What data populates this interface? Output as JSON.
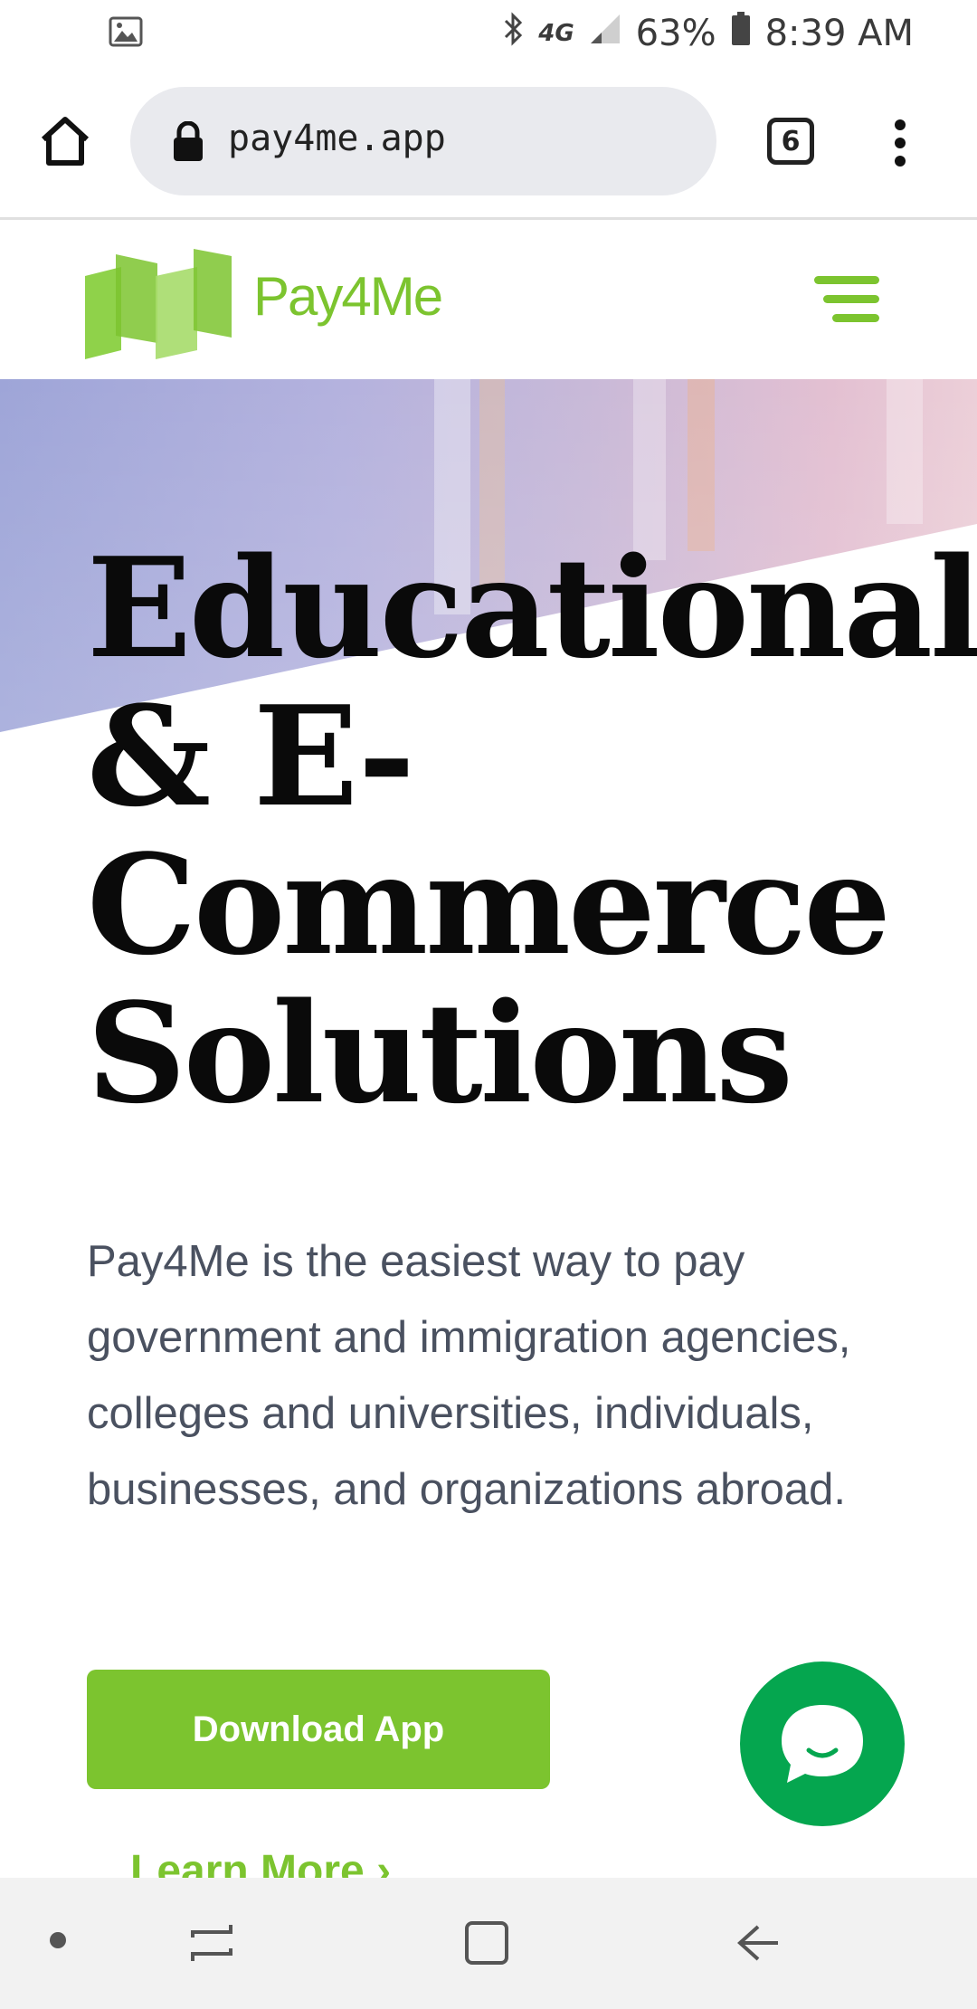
{
  "status_bar": {
    "network": "4G",
    "battery": "63%",
    "time": "8:39 AM"
  },
  "browser": {
    "url": "pay4me.app",
    "tab_count": "6"
  },
  "site": {
    "logo_text": "Pay4Me",
    "brand_color": "#7cc42f"
  },
  "hero": {
    "title_lines": [
      "Educational",
      "& E-",
      "Commerce",
      "Solutions"
    ],
    "description": "Pay4Me is the easiest way to pay government and immigration agencies, colleges and universities, individuals, businesses, and organizations abroad.",
    "download_label": "Download App",
    "learn_more_label": "Learn More"
  },
  "chat": {
    "color": "#05a64f"
  }
}
